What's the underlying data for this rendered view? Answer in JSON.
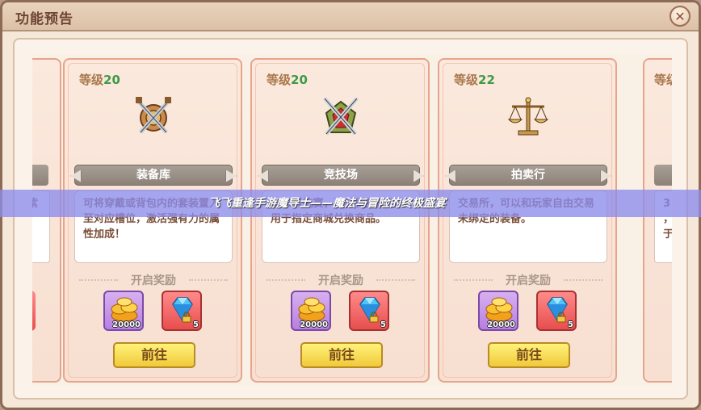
{
  "window": {
    "title": "功能预告",
    "close_label": "✕"
  },
  "colors": {
    "level_number": "#3f9a48",
    "banner": "#8b8178",
    "button": "#f0c93a",
    "promo_overlay": "#8c8ceb"
  },
  "cards": [
    {
      "level_label": "等级",
      "level_value": "20",
      "icon": "shield-swords-icon",
      "name": "装备库",
      "desc": "可将穿戴或背包内的套装置入至对应槽位，激活强有力的属性加成！",
      "reward_title": "开启奖励",
      "rewards": [
        {
          "icon": "gold-coins-icon",
          "count": "20000"
        },
        {
          "icon": "diamond-icon",
          "count": "5"
        }
      ],
      "button": "前往"
    },
    {
      "level_label": "等级",
      "level_value": "20",
      "icon": "crossed-swords-badge-icon",
      "name": "竞技场",
      "desc": "1v1对抗赛，可获得竞技币，用于指定商城兑换商品。",
      "reward_title": "开启奖励",
      "rewards": [
        {
          "icon": "gold-coins-icon",
          "count": "20000"
        },
        {
          "icon": "diamond-icon",
          "count": "5"
        }
      ],
      "button": "前往"
    },
    {
      "level_label": "等级",
      "level_value": "22",
      "icon": "scales-icon",
      "name": "拍卖行",
      "desc": "交易所，可以和玩家自由交易未绑定的装备。",
      "reward_title": "开启奖励",
      "rewards": [
        {
          "icon": "gold-coins-icon",
          "count": "20000"
        },
        {
          "icon": "diamond-icon",
          "count": "5"
        }
      ],
      "button": "前往"
    }
  ],
  "partial_left": {
    "text_line1": "之紫",
    "text_line2": "的"
  },
  "partial_right": {
    "level_label": "等级",
    "text_line1": "3",
    "text_line2": "，",
    "text_line3": "于"
  },
  "promo": {
    "text": "飞飞重逢手游魔导士——魔法与冒险的终极盛宴"
  }
}
